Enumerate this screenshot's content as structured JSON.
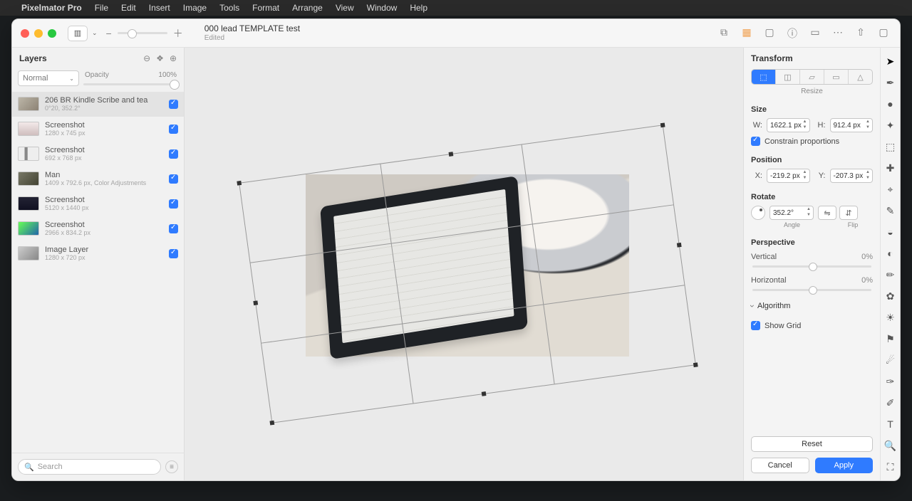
{
  "menubar": {
    "app": "Pixelmator Pro",
    "items": [
      "File",
      "Edit",
      "Insert",
      "Image",
      "Tools",
      "Format",
      "Arrange",
      "View",
      "Window",
      "Help"
    ]
  },
  "doc": {
    "title": "000 lead TEMPLATE test",
    "status": "Edited"
  },
  "layers_panel": {
    "title": "Layers",
    "blend_mode": "Normal",
    "opacity_label": "Opacity",
    "opacity_value": "100%",
    "search_placeholder": "Search",
    "items": [
      {
        "name": "206 BR Kindle Scribe and tea",
        "dims": "0°20, 352.2°",
        "selected": true
      },
      {
        "name": "Screenshot",
        "dims": "1280 x 745 px"
      },
      {
        "name": "Screenshot",
        "dims": "692 x 768 px"
      },
      {
        "name": "Man",
        "dims": "1409 x 792.6 px, Color Adjustments"
      },
      {
        "name": "Screenshot",
        "dims": "5120 x 1440 px"
      },
      {
        "name": "Screenshot",
        "dims": "2966 x 834.2 px"
      },
      {
        "name": "Image Layer",
        "dims": "1280 x 720 px"
      }
    ]
  },
  "transform": {
    "title": "Transform",
    "tabs_caption": "Resize",
    "size_title": "Size",
    "w_label": "W:",
    "w_value": "1622.1 px",
    "h_label": "H:",
    "h_value": "912.4 px",
    "constrain_label": "Constrain proportions",
    "position_title": "Position",
    "x_label": "X:",
    "x_value": "-219.2 px",
    "y_label": "Y:",
    "y_value": "-207.3 px",
    "rotate_title": "Rotate",
    "angle_value": "352.2°",
    "angle_caption": "Angle",
    "flip_caption": "Flip",
    "perspective_title": "Perspective",
    "vertical_label": "Vertical",
    "vertical_value": "0%",
    "horizontal_label": "Horizontal",
    "horizontal_value": "0%",
    "algorithm_label": "Algorithm",
    "show_grid_label": "Show Grid",
    "reset": "Reset",
    "cancel": "Cancel",
    "apply": "Apply"
  }
}
